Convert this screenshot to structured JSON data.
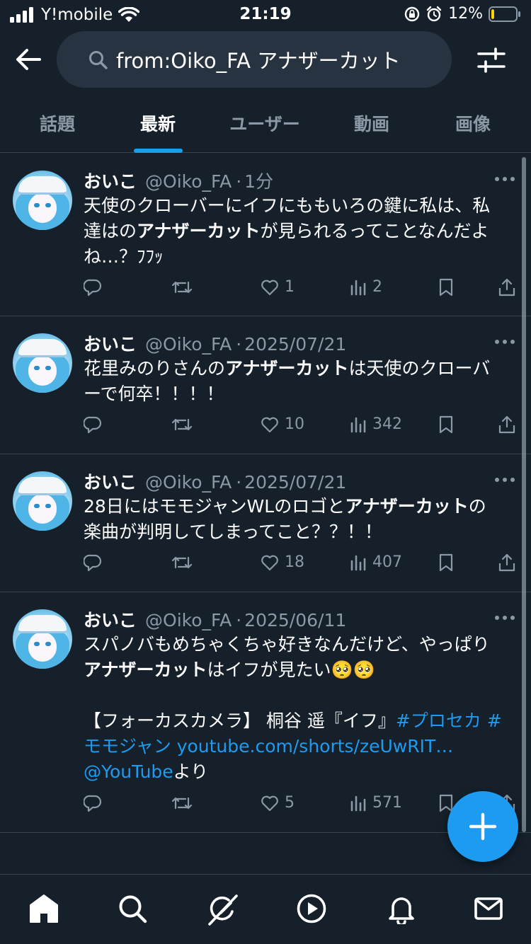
{
  "status_bar": {
    "carrier": "Y!mobile",
    "time": "21:19",
    "battery_percent": "12%",
    "battery_level": 0.12,
    "icons": [
      "signal-icon",
      "wifi-icon",
      "orientation-lock-icon",
      "alarm-icon",
      "battery-icon"
    ]
  },
  "header": {
    "search_query": "from:Oiko_FA アナザーカット"
  },
  "tabs": [
    {
      "label": "話題",
      "active": false
    },
    {
      "label": "最新",
      "active": true
    },
    {
      "label": "ユーザー",
      "active": false
    },
    {
      "label": "動画",
      "active": false
    },
    {
      "label": "画像",
      "active": false
    }
  ],
  "tweets": [
    {
      "name": "おいこ",
      "handle": "@Oiko_FA",
      "separator": "·",
      "time": "1分",
      "text_parts": [
        {
          "t": "天使のクローバーにイフにももいろの鍵に私は、私\n達はの",
          "style": "normal"
        },
        {
          "t": "アナザーカット",
          "style": "bold"
        },
        {
          "t": "が見られるってことなんだよ\nね…？ﾌﾌｯ",
          "style": "normal"
        }
      ],
      "replies": "",
      "retweets": "",
      "likes": "1",
      "views": "2"
    },
    {
      "name": "おいこ",
      "handle": "@Oiko_FA",
      "separator": "·",
      "time": "2025/07/21",
      "text_parts": [
        {
          "t": "花里みのりさんの",
          "style": "normal"
        },
        {
          "t": "アナザーカット",
          "style": "bold"
        },
        {
          "t": "は天使のクローバ\nーで何卒！！！！",
          "style": "normal"
        }
      ],
      "replies": "",
      "retweets": "",
      "likes": "10",
      "views": "342"
    },
    {
      "name": "おいこ",
      "handle": "@Oiko_FA",
      "separator": "·",
      "time": "2025/07/21",
      "text_parts": [
        {
          "t": "28日にはモモジャンWLのロゴと",
          "style": "normal"
        },
        {
          "t": "アナザーカット",
          "style": "bold"
        },
        {
          "t": "の\n楽曲が判明してしまってこと？？！！",
          "style": "normal"
        }
      ],
      "replies": "",
      "retweets": "",
      "likes": "18",
      "views": "407"
    },
    {
      "name": "おいこ",
      "handle": "@Oiko_FA",
      "separator": "·",
      "time": "2025/06/11",
      "text_parts": [
        {
          "t": "スパノバもめちゃくちゃ好きなんだけど、やっぱり\n",
          "style": "normal"
        },
        {
          "t": "アナザーカット",
          "style": "bold"
        },
        {
          "t": "はイフが見たい🥺🥺\n\n【フォーカスカメラ】 桐谷 遥『イフ』",
          "style": "normal"
        },
        {
          "t": "#プロセカ #\nモモジャン youtube.com/shorts/zeUwRIT…\n@YouTube",
          "style": "link"
        },
        {
          "t": "より",
          "style": "normal"
        }
      ],
      "replies": "",
      "retweets": "",
      "likes": "5",
      "views": "571"
    }
  ],
  "fab": {
    "icon": "plus-icon"
  },
  "bottom_nav": [
    "home-icon",
    "search-icon",
    "grok-icon",
    "video-icon",
    "bell-icon",
    "mail-icon"
  ],
  "colors": {
    "background": "#15202b",
    "accent": "#1d9bf0",
    "muted": "#8b98a5",
    "divider": "#38444d",
    "search_bg": "#273340"
  }
}
